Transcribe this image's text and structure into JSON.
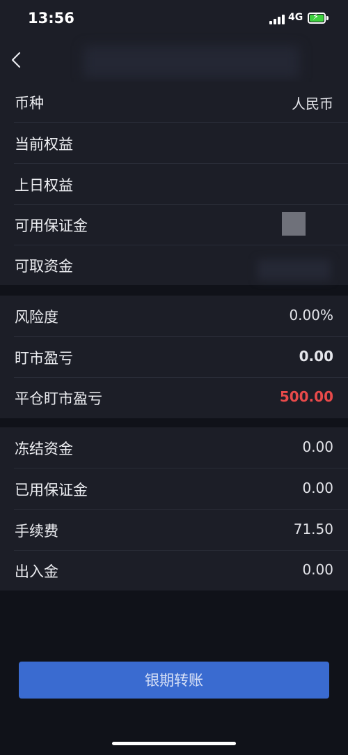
{
  "status_bar": {
    "time": "13:56",
    "network": "4G",
    "signal_icon": "cellular-signal-icon",
    "battery_icon": "battery-charging-icon",
    "battery_color": "#3fd13f"
  },
  "nav": {
    "back_icon": "chevron-left-icon"
  },
  "sections": [
    {
      "rows": [
        {
          "label": "币种",
          "value": "人民币"
        },
        {
          "label": "当前权益",
          "value": ""
        },
        {
          "label": "上日权益",
          "value": ""
        },
        {
          "label": "可用保证金",
          "value": ""
        },
        {
          "label": "可取资金",
          "value": ""
        }
      ]
    },
    {
      "rows": [
        {
          "label": "风险度",
          "value": "0.00%"
        },
        {
          "label": "盯市盈亏",
          "value": "0.00"
        },
        {
          "label": "平仓盯市盈亏",
          "value": "500.00"
        }
      ]
    },
    {
      "rows": [
        {
          "label": "冻结资金",
          "value": "0.00"
        },
        {
          "label": "已用保证金",
          "value": "0.00"
        },
        {
          "label": "手续费",
          "value": "71.50"
        },
        {
          "label": "出入金",
          "value": "0.00"
        }
      ]
    }
  ],
  "colors": {
    "accent": "#3a6bd0",
    "loss_red": "#e84a4a"
  },
  "actions": {
    "transfer_label": "银期转账"
  }
}
